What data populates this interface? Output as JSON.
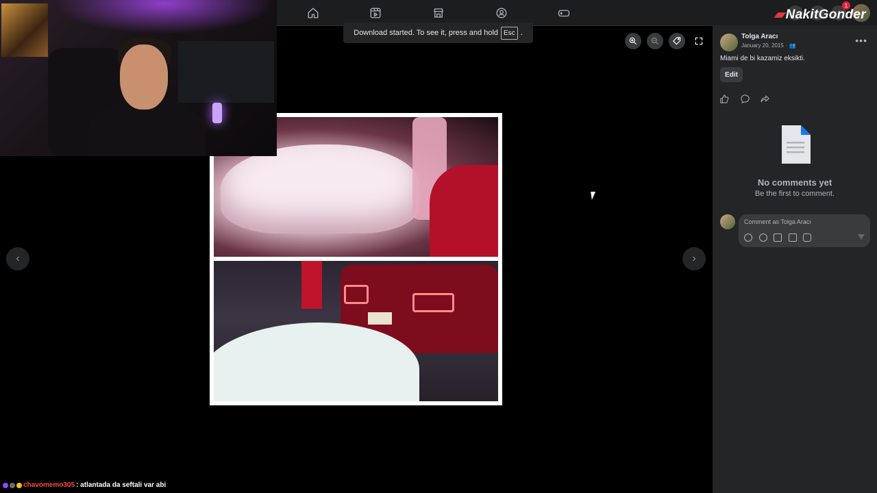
{
  "topbar": {
    "nav_icons": [
      "home-icon",
      "reels-icon",
      "marketplace-icon",
      "groups-icon",
      "gaming-icon"
    ],
    "brand": "NakitGonder",
    "notification_count": "1"
  },
  "toast": {
    "text": "Download started. To see it, press and hold",
    "key": "Esc",
    "suffix": "."
  },
  "viewer": {
    "tools": [
      "zoom-in-icon",
      "zoom-out-icon",
      "tag-icon",
      "fullscreen-icon"
    ],
    "prev_label": "‹",
    "next_label": "›"
  },
  "post": {
    "author": "Tolga Aracı",
    "date": "January 20, 2015 ·",
    "caption": "Miami de bi kazamiz eksikti.",
    "edit_label": "Edit",
    "more_label": "•••",
    "actions": [
      "like-icon",
      "comment-icon",
      "share-icon"
    ]
  },
  "comments": {
    "empty_title": "No comments yet",
    "empty_subtitle": "Be the first to comment.",
    "placeholder": "Comment as Tolga Aracı"
  },
  "chat": {
    "username": "chavomemo305",
    "message": ": atlantada da seftali var abi"
  },
  "colors": {
    "background": "#000000",
    "panel": "#242526",
    "topbar": "#1c1d1f",
    "chat_user": "#ff4b3e"
  }
}
